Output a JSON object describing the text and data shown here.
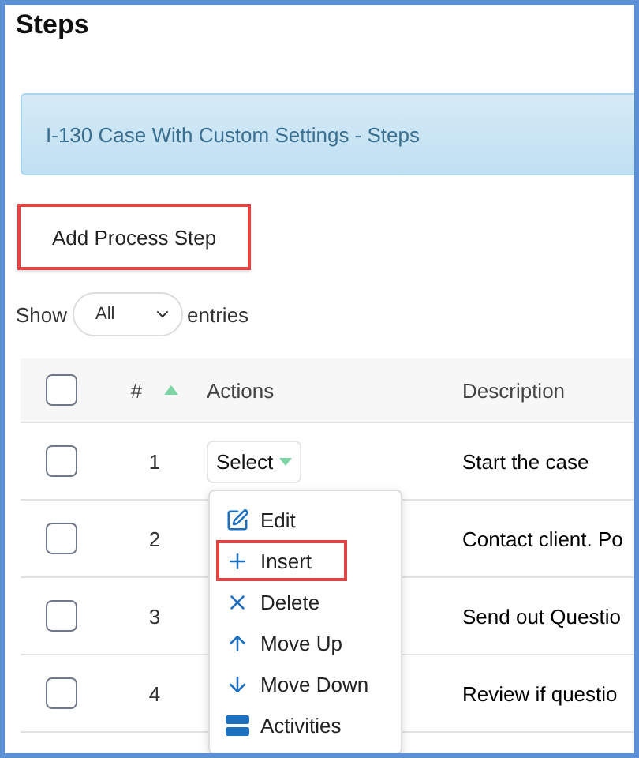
{
  "title": "Steps",
  "banner": "I-130 Case With Custom Settings - Steps",
  "add_button": {
    "label": "Add Process Step",
    "highlighted": true
  },
  "length": {
    "before": "Show",
    "value": "All",
    "after": "entries"
  },
  "table": {
    "select_all": {
      "checked": false
    },
    "columns": [
      {
        "label": "#",
        "sorted_ascending": true
      },
      {
        "label": "Actions"
      },
      {
        "label": "Description"
      }
    ],
    "rows": [
      {
        "checked": false,
        "number": "1",
        "action": "Select",
        "description": "Start the case"
      },
      {
        "checked": false,
        "number": "2",
        "description": "Contact client. Po"
      },
      {
        "checked": false,
        "number": "3",
        "description": "Send out Questio"
      },
      {
        "checked": false,
        "number": "4",
        "description": "Review if questio"
      }
    ]
  },
  "menu": [
    {
      "kind": "edit",
      "label": "Edit",
      "highlighted": false
    },
    {
      "kind": "insert",
      "label": "Insert",
      "highlighted": true
    },
    {
      "kind": "delete",
      "label": "Delete",
      "highlighted": false
    },
    {
      "kind": "up",
      "label": "Move Up",
      "highlighted": false
    },
    {
      "kind": "down",
      "label": "Move Down",
      "highlighted": false
    },
    {
      "kind": "activities",
      "label": "Activities",
      "highlighted": false
    }
  ]
}
